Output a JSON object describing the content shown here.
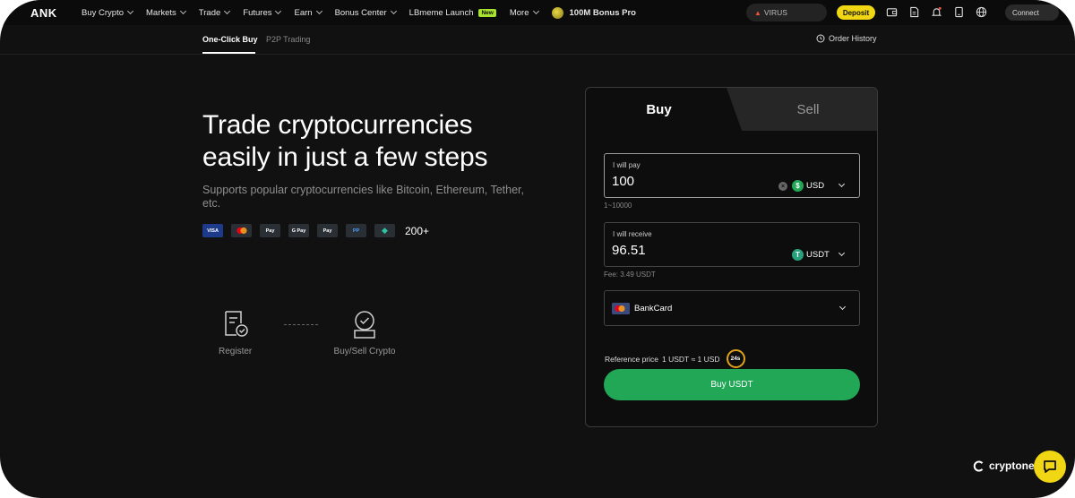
{
  "nav": {
    "logo": "ANK",
    "items": [
      {
        "label": "Buy Crypto"
      },
      {
        "label": "Markets"
      },
      {
        "label": "Trade"
      },
      {
        "label": "Futures"
      },
      {
        "label": "Earn"
      },
      {
        "label": "Bonus Center"
      }
    ],
    "launch": {
      "label": "LBmeme Launch",
      "badge": "New"
    },
    "more": "More",
    "bonus_pro": "100M Bonus Pro",
    "search_value": "VIRUS",
    "deposit": "Deposit",
    "connect": "Connect"
  },
  "subtabs": {
    "one_click": "One-Click Buy",
    "p2p": "P2P Trading",
    "order_history": "Order History"
  },
  "hero": {
    "title_line1": "Trade cryptocurrencies",
    "title_line2": "easily in just a few steps",
    "subtitle": "Supports popular cryptocurrencies like Bitcoin, Ethereum, Tether, etc.",
    "payment_methods": [
      "VISA",
      "MC",
      "Pay",
      "G Pay",
      "Pay",
      "PP",
      "◆"
    ],
    "count": "200+",
    "steps": [
      {
        "label": "Register",
        "icon": "register-icon"
      },
      {
        "label": "Buy/Sell Crypto",
        "icon": "buy-sell-icon"
      }
    ]
  },
  "card": {
    "tab_buy": "Buy",
    "tab_sell": "Sell",
    "pay": {
      "label": "I will pay",
      "value": "100",
      "currency": "USD",
      "range": "1~10000"
    },
    "receive": {
      "label": "I will receive",
      "value": "96.51",
      "currency": "USDT",
      "fee": "Fee: 3.49 USDT"
    },
    "method": {
      "label": "BankCard"
    },
    "reference": {
      "label": "Reference price",
      "value": "1 USDT ≈ 1 USD",
      "timer": "24s"
    },
    "buy_button": "Buy USDT"
  },
  "watermark": "cryptonews",
  "colors": {
    "accent_green": "#22a757",
    "deposit_yellow": "#f0d613",
    "background": "#111111"
  }
}
